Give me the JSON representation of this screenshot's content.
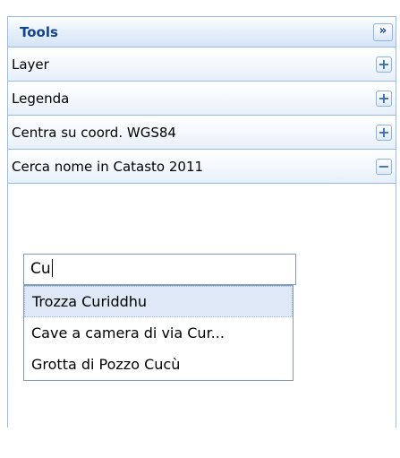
{
  "tools": {
    "title": "Tools",
    "collapse_glyph": "»",
    "collapse_icon": "double-chevron-right-icon"
  },
  "accordion": [
    {
      "label": "Layer",
      "toggle": "+",
      "expanded": false
    },
    {
      "label": "Legenda",
      "toggle": "+",
      "expanded": false
    },
    {
      "label": "Centra su coord. WGS84",
      "toggle": "+",
      "expanded": false
    },
    {
      "label": "Cerca nome in Catasto 2011",
      "toggle": "−",
      "expanded": true
    }
  ],
  "search": {
    "value": "Cu"
  },
  "suggestions": [
    {
      "label": "Trozza Curiddhu",
      "selected": true
    },
    {
      "label": "Cave a camera di via Cur...",
      "selected": false
    },
    {
      "label": "Grotta di Pozzo Cucù",
      "selected": false
    }
  ],
  "colors": {
    "border": "#99bbe8",
    "title_text": "#15428b",
    "selected_row": "#dfe8f6"
  }
}
